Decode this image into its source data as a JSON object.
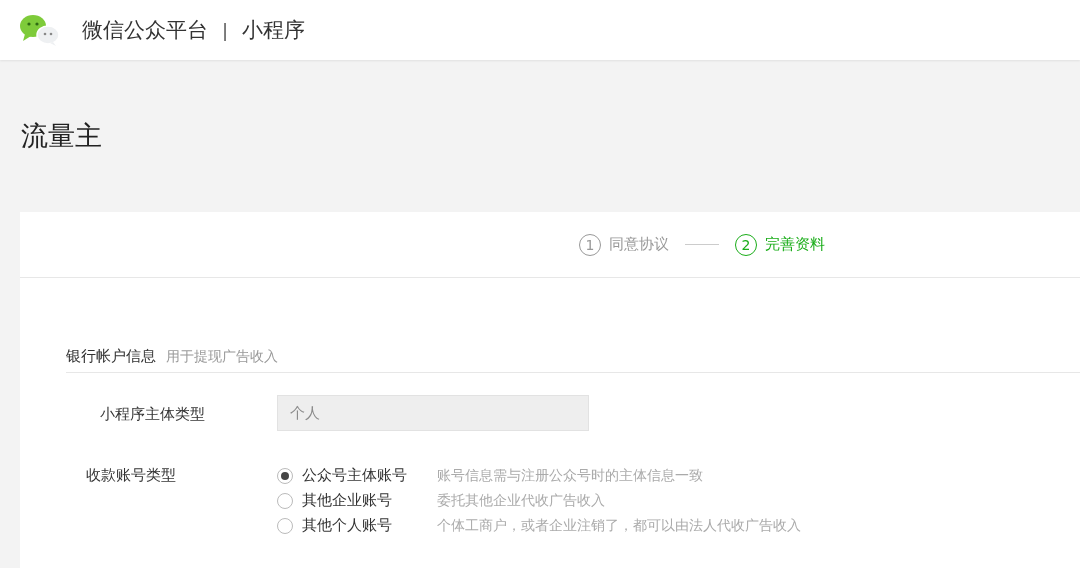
{
  "header": {
    "brand": "微信公众平台",
    "divider": "|",
    "product": "小程序"
  },
  "page_title": "流量主",
  "steps": [
    {
      "number": "1",
      "label": "同意协议",
      "selected": false
    },
    {
      "number": "2",
      "label": "完善资料",
      "selected": true
    }
  ],
  "section": {
    "title": "银行帐户信息",
    "hint": "用于提现广告收入"
  },
  "fields": [
    {
      "kind": "input",
      "label": "小程序主体类型",
      "value": "个人",
      "disabled": true
    },
    {
      "kind": "radio",
      "label": "收款账号类型",
      "options": [
        {
          "label": "公众号主体账号",
          "desc": "账号信息需与注册公众号时的主体信息一致",
          "selected": true
        },
        {
          "label": "其他企业账号",
          "desc": "委托其他企业代收广告收入",
          "selected": false
        },
        {
          "label": "其他个人账号",
          "desc": "个体工商户，或者企业注销了，都可以由法人代收广告收入",
          "selected": false
        }
      ]
    }
  ]
}
